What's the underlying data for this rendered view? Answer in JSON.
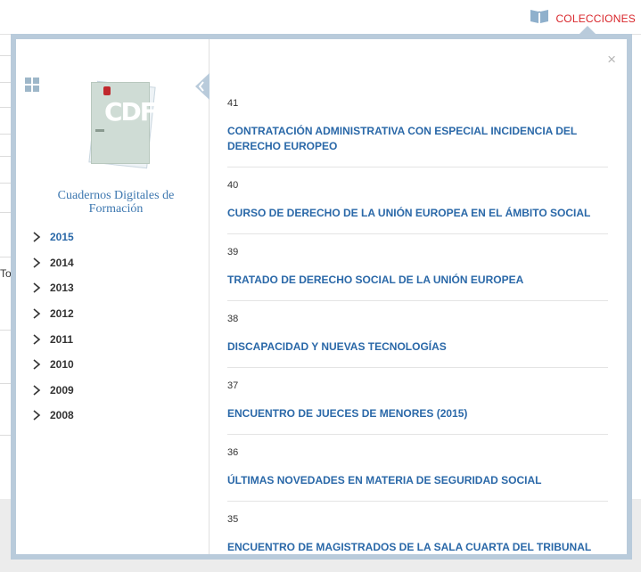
{
  "header": {
    "collections_label": "COLECCIONES",
    "collections_icon": "open-book-icon",
    "accent_color": "#d9262b"
  },
  "background": {
    "partial_text": "To"
  },
  "modal": {
    "close_label": "×",
    "sidebar": {
      "publication_title": "Cuadernos Digitales de Formación",
      "cover_logo": "CDF",
      "years": [
        {
          "label": "2015",
          "active": true
        },
        {
          "label": "2014",
          "active": false
        },
        {
          "label": "2013",
          "active": false
        },
        {
          "label": "2012",
          "active": false
        },
        {
          "label": "2011",
          "active": false
        },
        {
          "label": "2010",
          "active": false
        },
        {
          "label": "2009",
          "active": false
        },
        {
          "label": "2008",
          "active": false
        }
      ]
    },
    "entries": [
      {
        "number": "41",
        "title": "CONTRATACIÓN ADMINISTRATIVA CON ESPECIAL INCIDENCIA DEL DERECHO EUROPEO"
      },
      {
        "number": "40",
        "title": "CURSO DE DERECHO DE LA UNIÓN EUROPEA EN EL ÁMBITO SOCIAL"
      },
      {
        "number": "39",
        "title": "TRATADO DE DERECHO SOCIAL DE LA UNIÓN EUROPEA"
      },
      {
        "number": "38",
        "title": "DISCAPACIDAD Y NUEVAS TECNOLOGÍAS"
      },
      {
        "number": "37",
        "title": "ENCUENTRO DE JUECES DE MENORES (2015)"
      },
      {
        "number": "36",
        "title": "ÚLTIMAS NOVEDADES EN MATERIA DE SEGURIDAD SOCIAL"
      },
      {
        "number": "35",
        "title": "ENCUENTRO DE MAGISTRADOS DE LA SALA CUARTA DEL TRIBUNAL SUPREMO CON PRESIDENTES DE LAS SALAS DE LO SOCIAL DE LOS TRIBUNALES SUPERIORES DE JUSTICIA Y DE LA AUDIENCIA NACIONAL"
      }
    ]
  }
}
